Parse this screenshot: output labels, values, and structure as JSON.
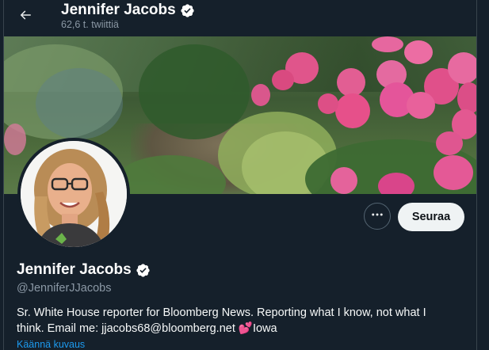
{
  "header": {
    "name": "Jennifer Jacobs",
    "tweet_count": "62,6 t. twiittiä"
  },
  "profile": {
    "name": "Jennifer Jacobs",
    "handle": "@JenniferJJacobs",
    "bio_line1": "Sr. White House reporter for Bloomberg News. Reporting what I know, not what I",
    "bio_line2_text": "think. Email me: jjacobs68@bloomberg.net",
    "bio_emoji": "💕",
    "bio_location": "Iowa",
    "translate_label": "Käännä kuvaus"
  },
  "buttons": {
    "more_label": "•••",
    "follow_label": "Seuraa"
  },
  "icons": {
    "back": "back-arrow-icon",
    "verified": "verified-badge-icon",
    "more": "more-horizontal-icon"
  },
  "colors": {
    "background": "#15202b",
    "accent": "#1d9bf0",
    "secondary_text": "#8b98a5",
    "follow_bg": "#eff3f4"
  }
}
